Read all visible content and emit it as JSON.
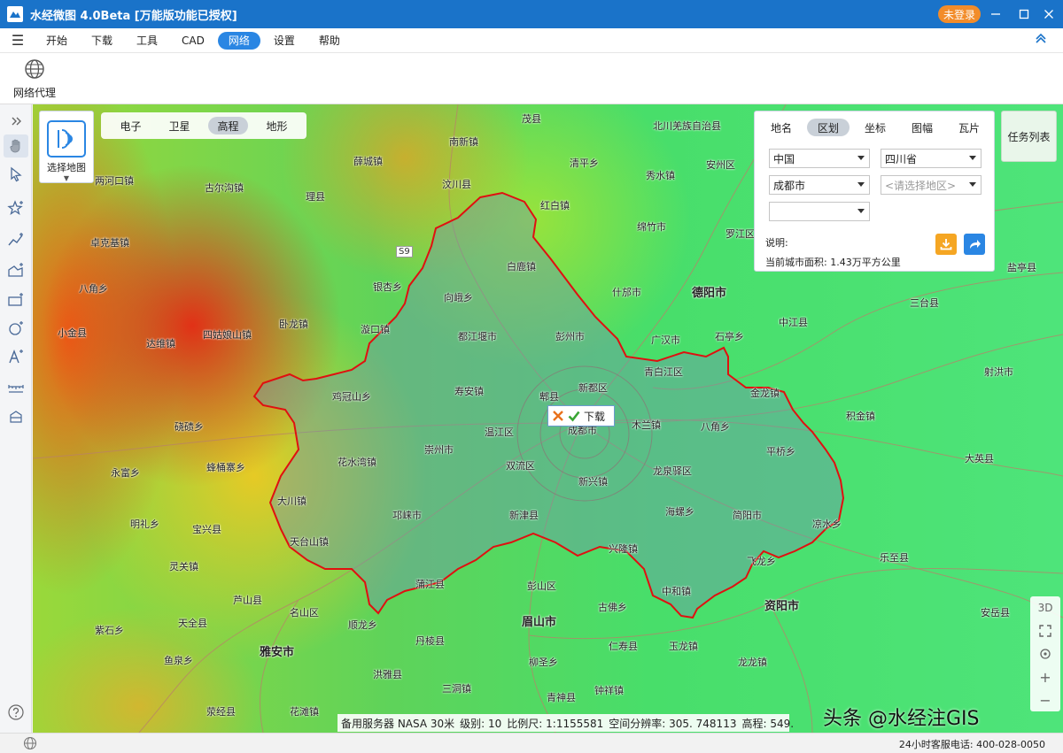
{
  "app": {
    "title": "水经微图 4.0Beta [万能版功能已授权]",
    "login_label": "未登录"
  },
  "menu": {
    "items": [
      "开始",
      "下载",
      "工具",
      "CAD",
      "网络",
      "设置",
      "帮助"
    ],
    "active": "网络"
  },
  "ribbon": {
    "proxy_label": "网络代理"
  },
  "map_selector": {
    "label": "选择地图"
  },
  "tile_tabs": {
    "items": [
      "电子",
      "卫星",
      "高程",
      "地形"
    ],
    "active": "高程"
  },
  "panel": {
    "tabs": [
      "地名",
      "区划",
      "坐标",
      "图幅",
      "瓦片"
    ],
    "active_tab": "区划",
    "country": "中国",
    "province": "四川省",
    "city": "成都市",
    "district_placeholder": "<请选择地区>",
    "extra": "",
    "note_label": "说明:",
    "area_text": "当前城市面积: 1.43万平方公里"
  },
  "task_list_label": "任务列表",
  "download_popup_label": "下载",
  "map_controls": {
    "three_d": "3D",
    "zoom_in": "+",
    "zoom_out": "−"
  },
  "map_status": {
    "server": "备用服务器 NASA 30米",
    "level": "级别: 10",
    "scale": "比例尺: 1:1155581",
    "resolution": "空间分辨率: 305. 748113",
    "elevation": "高程: 549."
  },
  "watermark": "头条 @水经注GIS",
  "status_phone": "24小时客服电话: 400-028-0050",
  "places": [
    {
      "name": "茂县",
      "big": false
    },
    {
      "name": "北川羌族自治县",
      "big": false
    },
    {
      "name": "南新镇",
      "big": false
    },
    {
      "name": "薛城镇",
      "big": false
    },
    {
      "name": "清平乡",
      "big": false
    },
    {
      "name": "安州区",
      "big": false
    },
    {
      "name": "两河口镇",
      "big": false
    },
    {
      "name": "古尔沟镇",
      "big": false
    },
    {
      "name": "汶川县",
      "big": false
    },
    {
      "name": "秀水镇",
      "big": false
    },
    {
      "name": "理县",
      "big": false
    },
    {
      "name": "红白镇",
      "big": false
    },
    {
      "name": "绵竹市",
      "big": false
    },
    {
      "name": "罗江区",
      "big": false
    },
    {
      "name": "卓克基镇",
      "big": false
    },
    {
      "name": "S9",
      "big": false
    },
    {
      "name": "白鹿镇",
      "big": false
    },
    {
      "name": "什邡市",
      "big": false
    },
    {
      "name": "德阳市",
      "big": true
    },
    {
      "name": "八角乡",
      "big": false
    },
    {
      "name": "银杏乡",
      "big": false
    },
    {
      "name": "向峨乡",
      "big": false
    },
    {
      "name": "卧龙镇",
      "big": false
    },
    {
      "name": "小金县",
      "big": false
    },
    {
      "name": "四姑娘山镇",
      "big": false
    },
    {
      "name": "漩口镇",
      "big": false
    },
    {
      "name": "都江堰市",
      "big": false
    },
    {
      "name": "彭州市",
      "big": false
    },
    {
      "name": "广汉市",
      "big": false
    },
    {
      "name": "石亭乡",
      "big": false
    },
    {
      "name": "中江县",
      "big": false
    },
    {
      "name": "达维镇",
      "big": false
    },
    {
      "name": "青白江区",
      "big": false
    },
    {
      "name": "寿安镇",
      "big": false
    },
    {
      "name": "鸡冠山乡",
      "big": false
    },
    {
      "name": "郫县",
      "big": false
    },
    {
      "name": "新都区",
      "big": false
    },
    {
      "name": "金龙镇",
      "big": false
    },
    {
      "name": "硗碛乡",
      "big": false
    },
    {
      "name": "温江区",
      "big": false
    },
    {
      "name": "成都市",
      "big": false
    },
    {
      "name": "木兰镇",
      "big": false
    },
    {
      "name": "八角乡",
      "big": false
    },
    {
      "name": "崇州市",
      "big": false
    },
    {
      "name": "平桥乡",
      "big": false
    },
    {
      "name": "花水湾镇",
      "big": false
    },
    {
      "name": "双流区",
      "big": false
    },
    {
      "name": "龙泉驿区",
      "big": false
    },
    {
      "name": "蜂桶寨乡",
      "big": false
    },
    {
      "name": "永富乡",
      "big": false
    },
    {
      "name": "新兴镇",
      "big": false
    },
    {
      "name": "大川镇",
      "big": false
    },
    {
      "name": "邛崃市",
      "big": false
    },
    {
      "name": "新津县",
      "big": false
    },
    {
      "name": "海螺乡",
      "big": false
    },
    {
      "name": "简阳市",
      "big": false
    },
    {
      "name": "凉水乡",
      "big": false
    },
    {
      "name": "宝兴县",
      "big": false
    },
    {
      "name": "明礼乡",
      "big": false
    },
    {
      "name": "天台山镇",
      "big": false
    },
    {
      "name": "兴隆镇",
      "big": false
    },
    {
      "name": "灵关镇",
      "big": false
    },
    {
      "name": "蒲江县",
      "big": false
    },
    {
      "name": "彭山区",
      "big": false
    },
    {
      "name": "飞龙乡",
      "big": false
    },
    {
      "name": "中和镇",
      "big": false
    },
    {
      "name": "芦山县",
      "big": false
    },
    {
      "name": "资阳市",
      "big": true
    },
    {
      "name": "天全县",
      "big": false
    },
    {
      "name": "名山区",
      "big": false
    },
    {
      "name": "眉山市",
      "big": true
    },
    {
      "name": "古佛乡",
      "big": false
    },
    {
      "name": "紫石乡",
      "big": false
    },
    {
      "name": "顺龙乡",
      "big": false
    },
    {
      "name": "雅安市",
      "big": true
    },
    {
      "name": "丹棱县",
      "big": false
    },
    {
      "name": "仁寿县",
      "big": false
    },
    {
      "name": "玉龙镇",
      "big": false
    },
    {
      "name": "鱼泉乡",
      "big": false
    },
    {
      "name": "洪雅县",
      "big": false
    },
    {
      "name": "柳圣乡",
      "big": false
    },
    {
      "name": "龙龙镇",
      "big": false
    },
    {
      "name": "三洞镇",
      "big": false
    },
    {
      "name": "青神县",
      "big": false
    },
    {
      "name": "钟祥镇",
      "big": false
    },
    {
      "name": "荥经县",
      "big": false
    },
    {
      "name": "花滩镇",
      "big": false
    },
    {
      "name": "盐亭县",
      "big": false
    },
    {
      "name": "三台县",
      "big": false
    },
    {
      "name": "射洪市",
      "big": false
    },
    {
      "name": "乐至县",
      "big": false
    },
    {
      "name": "安岳县",
      "big": false
    },
    {
      "name": "大英县",
      "big": false
    },
    {
      "name": "积金镇",
      "big": false
    }
  ]
}
